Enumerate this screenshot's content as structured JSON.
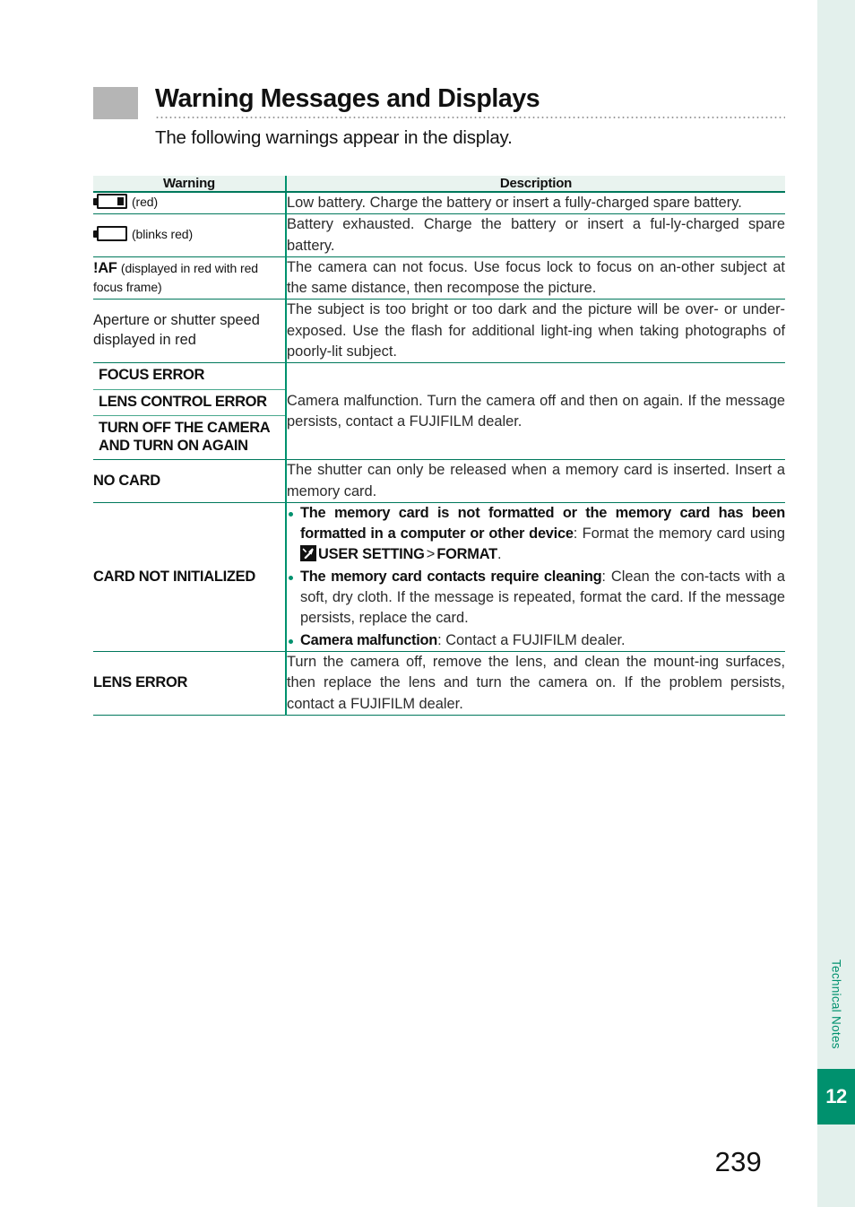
{
  "section": {
    "title": "Warning Messages and Displays",
    "subtitle": "The following warnings appear in the display."
  },
  "sidebar": {
    "chapter_label": "Technical Notes",
    "chapter_number": "12",
    "strip_color": "#e3f0ec",
    "accent_color": "#00916e"
  },
  "page_number": "239",
  "table": {
    "headers": {
      "warning": "Warning",
      "description": "Description"
    },
    "rows": [
      {
        "icon": "battery-low-icon",
        "label_note": "(red)",
        "description": "Low battery. Charge the battery or insert a fully-charged spare battery."
      },
      {
        "icon": "battery-empty-icon",
        "label_note": "(blinks red)",
        "description": "Battery exhausted. Charge the battery or insert a ful-ly-charged spare battery."
      },
      {
        "label_bold": "!AF",
        "label_note": "(displayed in red with red focus frame)",
        "description": "The camera can not focus. Use focus lock to focus on an-other subject at the same distance, then recompose the picture."
      },
      {
        "label_plain": "Aperture or shutter speed displayed in red",
        "description": "The subject is too bright or too dark and the picture will be over- or under-exposed. Use the flash for additional light-ing when taking photographs of poorly-lit subject."
      },
      {
        "label_stack": [
          "FOCUS ERROR",
          "LENS CONTROL ERROR",
          "TURN OFF THE CAMERA AND TURN ON AGAIN"
        ],
        "description": "Camera malfunction. Turn the camera off and then on again. If the message persists, contact a FUJIFILM dealer."
      },
      {
        "label_bold": "NO CARD",
        "description": "The shutter can only be released when a memory card is inserted. Insert a memory card."
      },
      {
        "label_bold": "CARD NOT INITIALIZED",
        "bullets": [
          {
            "bold": "The memory card is not formatted or the memory card has been formatted in a computer or other device",
            "sep": ": ",
            "text_before_icon": "Format the memory card using ",
            "icon": "wrench-setting-icon",
            "menu_path": "USER SETTING",
            "menu_sep": ">",
            "menu_target": "FORMAT",
            "text_after": "."
          },
          {
            "bold": "The memory card contacts require cleaning",
            "sep": ": ",
            "text": "Clean the con-tacts with a soft, dry cloth. If the message is repeated, format the card. If the message persists, replace the card."
          },
          {
            "bold": "Camera malfunction",
            "sep": ": ",
            "text": "Contact a FUJIFILM dealer."
          }
        ]
      },
      {
        "label_bold": "LENS ERROR",
        "description": "Turn the camera off, remove the lens, and clean the mount-ing surfaces, then replace the lens and turn the camera on. If the problem persists, contact a FUJIFILM dealer."
      }
    ]
  }
}
